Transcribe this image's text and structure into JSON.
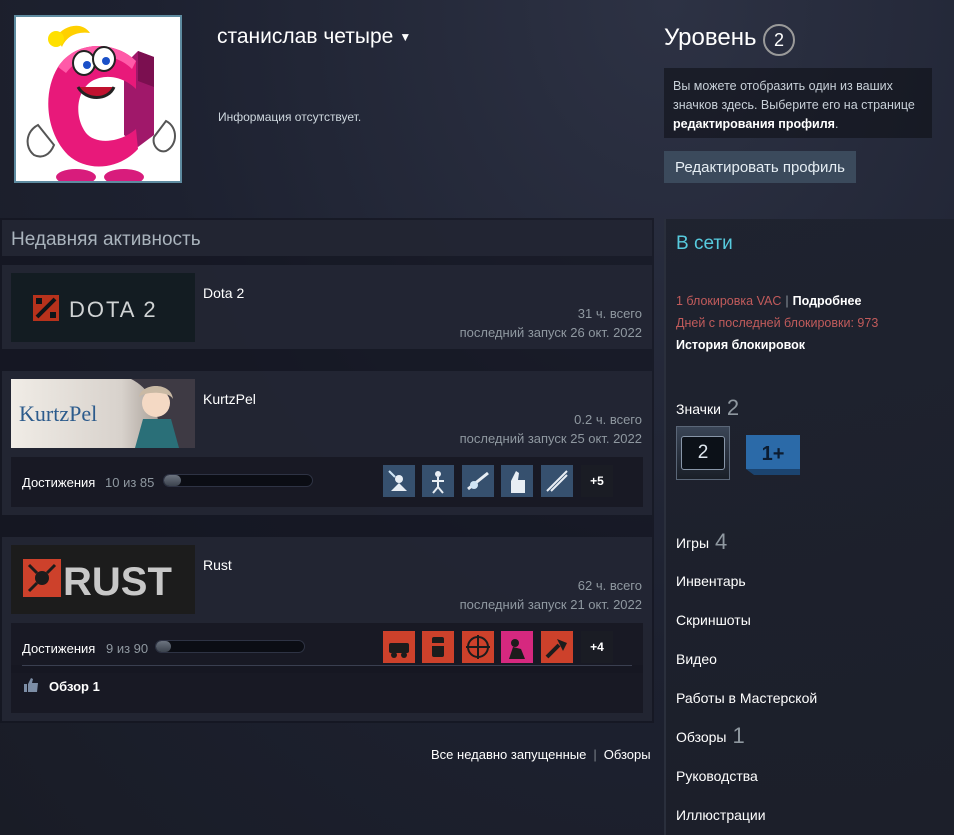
{
  "profile": {
    "name": "станислав четыре",
    "summary": "Информация отсутствует."
  },
  "level": {
    "title": "Уровень",
    "value": "2",
    "hint_text": "Вы можете отобразить один из ваших значков здесь. Выберите его на странице ",
    "hint_link": "редактирования профиля",
    "hint_end": ".",
    "edit_button": "Редактировать профиль"
  },
  "activity": {
    "header": "Недавняя активность",
    "games": [
      {
        "name": "Dota 2",
        "hours": "31 ч. всего",
        "last_played": "последний запуск 26 окт. 2022",
        "logo_text": "DOTA 2"
      },
      {
        "name": "KurtzPel",
        "hours": "0.2 ч. всего",
        "last_played": "последний запуск 25 окт. 2022",
        "logo_text": "KurtzPel",
        "achievements": {
          "label": "Достижения",
          "count": "10 из 85",
          "fraction": 0.118,
          "more": "+5"
        }
      },
      {
        "name": "Rust",
        "hours": "62 ч. всего",
        "last_played": "последний запуск 21 окт. 2022",
        "logo_text": "RUST",
        "achievements": {
          "label": "Достижения",
          "count": "9 из 90",
          "fraction": 0.1,
          "more": "+4"
        },
        "review": "Обзор 1"
      }
    ],
    "footer": {
      "all_recent": "Все недавно запущенные",
      "sep": "|",
      "reviews": "Обзоры"
    }
  },
  "sidebar": {
    "status": "В сети",
    "vac": "1 блокировка VAC",
    "vac_sep": "|",
    "vac_more": "Подробнее",
    "vac_days": "Дней с последней блокировки: 973",
    "ban_history": "История блокировок",
    "badges": {
      "label": "Значки",
      "count": "2",
      "badge1_value": "2",
      "badge2_value": "1+"
    },
    "items": [
      {
        "label": "Игры",
        "count": "4"
      },
      {
        "label": "Инвентарь",
        "count": ""
      },
      {
        "label": "Скриншоты",
        "count": ""
      },
      {
        "label": "Видео",
        "count": ""
      },
      {
        "label": "Работы в Мастерской",
        "count": ""
      },
      {
        "label": "Обзоры",
        "count": "1"
      },
      {
        "label": "Руководства",
        "count": ""
      },
      {
        "label": "Иллюстрации",
        "count": ""
      }
    ]
  },
  "colors": {
    "online": "#57cbde",
    "vac": "#c15b5b",
    "rust_icon": "#cd412b",
    "kurtz_icon": "#36506e"
  }
}
